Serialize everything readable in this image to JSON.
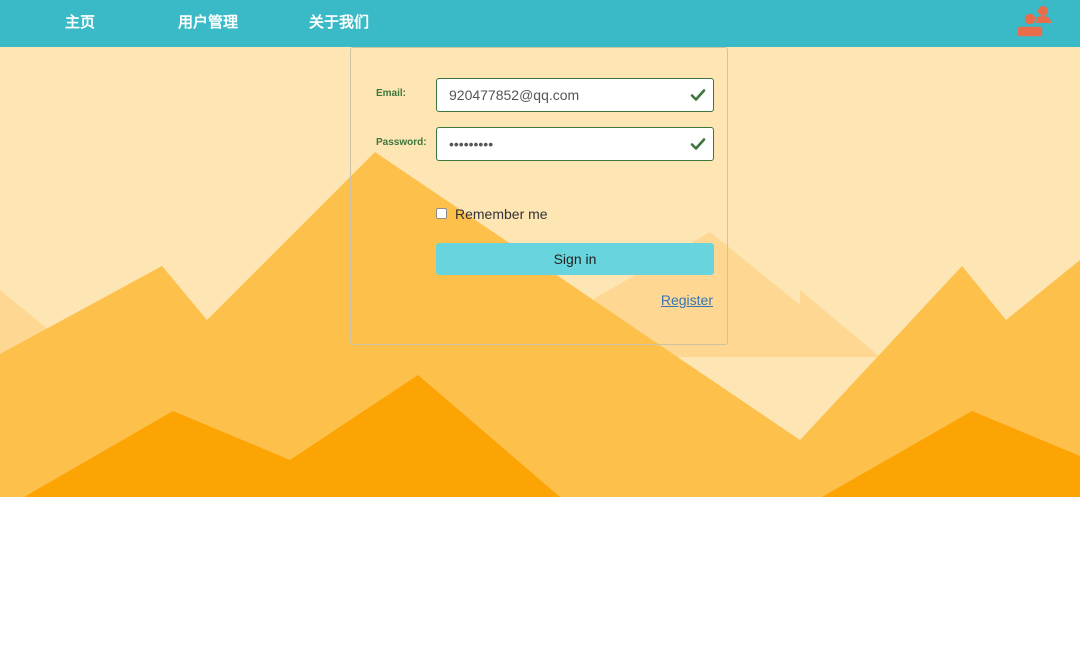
{
  "nav": {
    "items": [
      {
        "label": "主页"
      },
      {
        "label": "用户管理"
      },
      {
        "label": "关于我们"
      }
    ],
    "user_icon": "user-group-icon"
  },
  "colors": {
    "navbar": "#3ab9c6",
    "sky": "#fee5b4",
    "mountain_light": "#fed892",
    "mountain_mid": "#fdc04a",
    "mountain_dark": "#fca404",
    "valid_green": "#3c763d",
    "button": "#68d4dd",
    "link": "#3775b5",
    "user_icon": "#e96d4b"
  },
  "login": {
    "email_label": "Email:",
    "email_value": "920477852@qq.com",
    "password_label": "Password:",
    "password_value": "123456789",
    "remember_label": "Remember me",
    "remember_checked": false,
    "signin_label": "Sign in",
    "register_label": "Register",
    "valid_icon": "checkmark-icon"
  }
}
